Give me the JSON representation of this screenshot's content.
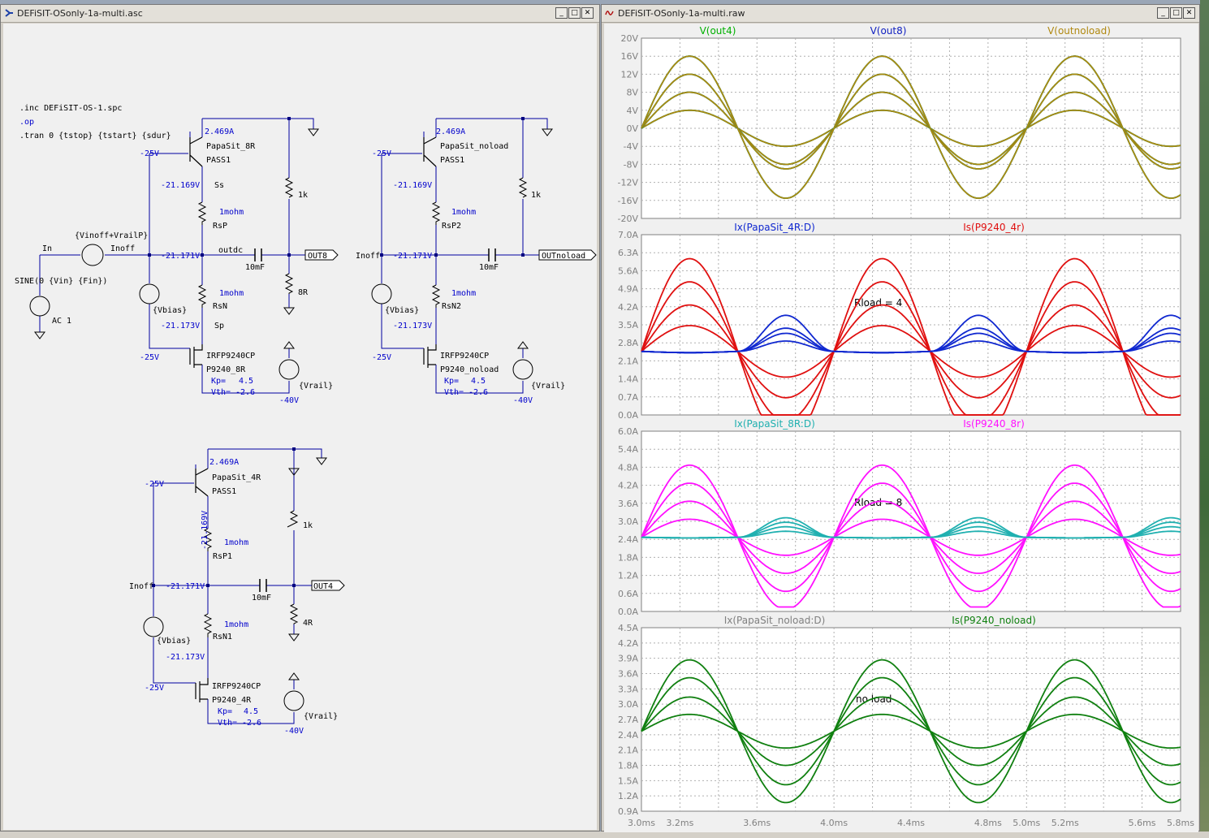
{
  "schematic": {
    "title": "DEFiSIT-OSonly-1a-multi.asc",
    "directives": [
      ".inc DEFiSIT-OS-1.spc",
      ".op",
      ".tran 0 {tstop} {tstart} {sdur}"
    ],
    "source": {
      "in": "In",
      "spec": "SINE(0 {Vin} {Fin})",
      "ac": "AC 1",
      "vin": "{Vinoff+VrailP}",
      "inoff": "Inoff"
    },
    "c1": {
      "current": "2.469A",
      "jfet": "PapaSit_8R",
      "jfet_model": "PASS1",
      "gate": "-25V",
      "ss_v": "-21.169V",
      "ss": "Ss",
      "rsp_val": "1mohm",
      "rsp": "RsP",
      "mid_v": "-21.171V",
      "outdc": "outdc",
      "cap": "10mF",
      "out": "OUT8",
      "r1k": "1k",
      "rload": "8R",
      "rsn_val": "1mohm",
      "rsn": "RsN",
      "sp_v": "-21.173V",
      "sp": "Sp",
      "gate2": "-25V",
      "mos_model": "IRFP9240CP",
      "mos": "P9240_8R",
      "kp": "Kp=",
      "kp_v": "4.5",
      "vth": "Vth=",
      "vth_v": "-2.6",
      "rail": "{Vrail}",
      "rail_v": "-40V",
      "vbias": "{Vbias}"
    },
    "c2": {
      "current": "2.469A",
      "jfet": "PapaSit_noload",
      "jfet_model": "PASS1",
      "gate": "-25V",
      "ss_v": "-21.169V",
      "rsp_val": "1mohm",
      "rsp": "RsP2",
      "inoff": "Inoff",
      "mid_v": "-21.171V",
      "cap": "10mF",
      "out": "OUTnoload",
      "r1k": "1k",
      "rsn_val": "1mohm",
      "rsn": "RsN2",
      "sp_v": "-21.173V",
      "gate2": "-25V",
      "mos_model": "IRFP9240CP",
      "mos": "P9240_noload",
      "kp": "Kp=",
      "kp_v": "4.5",
      "vth": "Vth=",
      "vth_v": "-2.6",
      "rail": "{Vrail}",
      "rail_v": "-40V",
      "vbias": "{Vbias}"
    },
    "c3": {
      "current": "2.469A",
      "jfet": "PapaSit_4R",
      "jfet_model": "PASS1",
      "gate": "-25V",
      "ss_v": "-21.169V",
      "rsp_val": "1mohm",
      "rsp": "RsP1",
      "inoff": "Inoff",
      "mid_v": "-21.171V",
      "cap": "10mF",
      "out": "OUT4",
      "r1k": "1k",
      "rload": "4R",
      "rsn_val": "1mohm",
      "rsn": "RsN1",
      "sp_v": "-21.173V",
      "gate2": "-25V",
      "mos_model": "IRFP9240CP",
      "mos": "P9240_4R",
      "kp": "Kp=",
      "kp_v": "4.5",
      "vth": "Vth=",
      "vth_v": "-2.6",
      "rail": "{Vrail}",
      "rail_v": "-40V",
      "vbias": "{Vbias}"
    }
  },
  "waveform": {
    "title": "DEFiSIT-OSonly-1a-multi.raw",
    "colors": {
      "out4": "#00b000",
      "out8": "#1020c0",
      "outnoload": "#b08810",
      "ix4": "#1028d0",
      "is4": "#e01010",
      "ix8": "#20b0b0",
      "is8": "#ff10ff",
      "ixn": "#808080",
      "isn": "#108010"
    },
    "x_labels": [
      "3.0ms",
      "3.2ms",
      "3.6ms",
      "4.0ms",
      "4.4ms",
      "4.8ms",
      "5.0ms",
      "5.2ms",
      "5.6ms",
      "5.8ms"
    ],
    "chart_data": [
      {
        "type": "line",
        "series": [
          {
            "name": "V(out4)"
          },
          {
            "name": "V(out8)"
          },
          {
            "name": "V(outnoload)"
          }
        ],
        "x_range": [
          3.0,
          5.8
        ],
        "ylim": [
          -20,
          20
        ],
        "ylabels": [
          "20V",
          "16V",
          "12V",
          "8V",
          "4V",
          "0V",
          "-4V",
          "-8V",
          "-12V",
          "-16V",
          "-20V"
        ],
        "amplitudes": [
          4,
          8,
          12,
          16
        ],
        "offset": 0
      },
      {
        "type": "line",
        "series": [
          {
            "name": "Ix(PapaSit_4R:D)"
          },
          {
            "name": "Is(P9240_4r)"
          }
        ],
        "annotation": "Rload = 4",
        "x_range": [
          3.0,
          5.8
        ],
        "ylim": [
          0,
          7
        ],
        "ylabels": [
          "7.0A",
          "6.3A",
          "5.6A",
          "4.9A",
          "4.2A",
          "3.5A",
          "2.8A",
          "2.1A",
          "1.4A",
          "0.7A",
          "0.0A"
        ],
        "amplitudes": [
          1,
          1.8,
          2.7,
          3.6
        ],
        "offset": 2.469
      },
      {
        "type": "line",
        "series": [
          {
            "name": "Ix(PapaSit_8R:D)"
          },
          {
            "name": "Is(P9240_8r)"
          }
        ],
        "annotation": "Rload = 8",
        "x_range": [
          3.0,
          5.8
        ],
        "ylim": [
          0,
          6
        ],
        "ylabels": [
          "6.0A",
          "5.4A",
          "4.8A",
          "4.2A",
          "3.6A",
          "3.0A",
          "2.4A",
          "1.8A",
          "1.2A",
          "0.6A",
          "0.0A"
        ],
        "amplitudes": [
          0.6,
          1.2,
          1.8,
          2.4
        ],
        "offset": 2.469
      },
      {
        "type": "line",
        "series": [
          {
            "name": "Ix(PapaSit_noload:D)"
          },
          {
            "name": "Is(P9240_noload)"
          }
        ],
        "annotation": "no load",
        "x_range": [
          3.0,
          5.8
        ],
        "ylim": [
          0.9,
          4.5
        ],
        "ylabels": [
          "4.5A",
          "4.2A",
          "3.9A",
          "3.6A",
          "3.3A",
          "3.0A",
          "2.7A",
          "2.4A",
          "2.1A",
          "1.8A",
          "1.5A",
          "1.2A",
          "0.9A"
        ],
        "amplitudes": [
          0.33,
          0.67,
          1.05,
          1.4
        ],
        "offset": 2.469
      }
    ]
  }
}
